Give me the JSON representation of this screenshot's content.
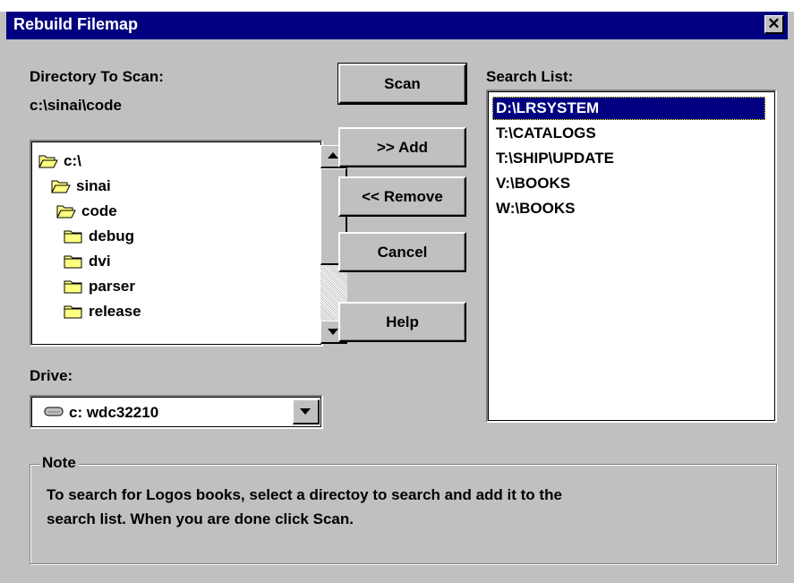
{
  "window": {
    "title": "Rebuild Filemap",
    "close_glyph": "✕"
  },
  "directory": {
    "label": "Directory To Scan:",
    "path": "c:\\sinai\\code",
    "tree": [
      {
        "name": "c:\\",
        "icon": "folder-open-icon",
        "level": 0
      },
      {
        "name": "sinai",
        "icon": "folder-open-icon",
        "level": 1
      },
      {
        "name": "code",
        "icon": "folder-open-icon",
        "level": 2
      },
      {
        "name": "debug",
        "icon": "folder-closed-icon",
        "level": 3
      },
      {
        "name": "dvi",
        "icon": "folder-closed-icon",
        "level": 3
      },
      {
        "name": "parser",
        "icon": "folder-closed-icon",
        "level": 3
      },
      {
        "name": "release",
        "icon": "folder-closed-icon",
        "level": 3
      }
    ]
  },
  "drive": {
    "label": "Drive:",
    "selected": "c: wdc32210",
    "icon": "hard-drive-icon"
  },
  "buttons": {
    "scan": "Scan",
    "add": ">> Add",
    "remove": "<< Remove",
    "cancel": "Cancel",
    "help": "Help"
  },
  "search_list": {
    "label": "Search List:",
    "items": [
      "D:\\LRSYSTEM",
      "T:\\CATALOGS",
      "T:\\SHIP\\UPDATE",
      "V:\\BOOKS",
      "W:\\BOOKS"
    ],
    "selected_index": 0
  },
  "note": {
    "title": "Note",
    "line1": "To search for Logos books, select a directoy to search and add it to the",
    "line2": "search list.  When you are done click Scan."
  },
  "colors": {
    "titlebar": "#000080",
    "dialog_bg": "#c0c0c0",
    "selection": "#000080",
    "folder": "#ffff80"
  }
}
